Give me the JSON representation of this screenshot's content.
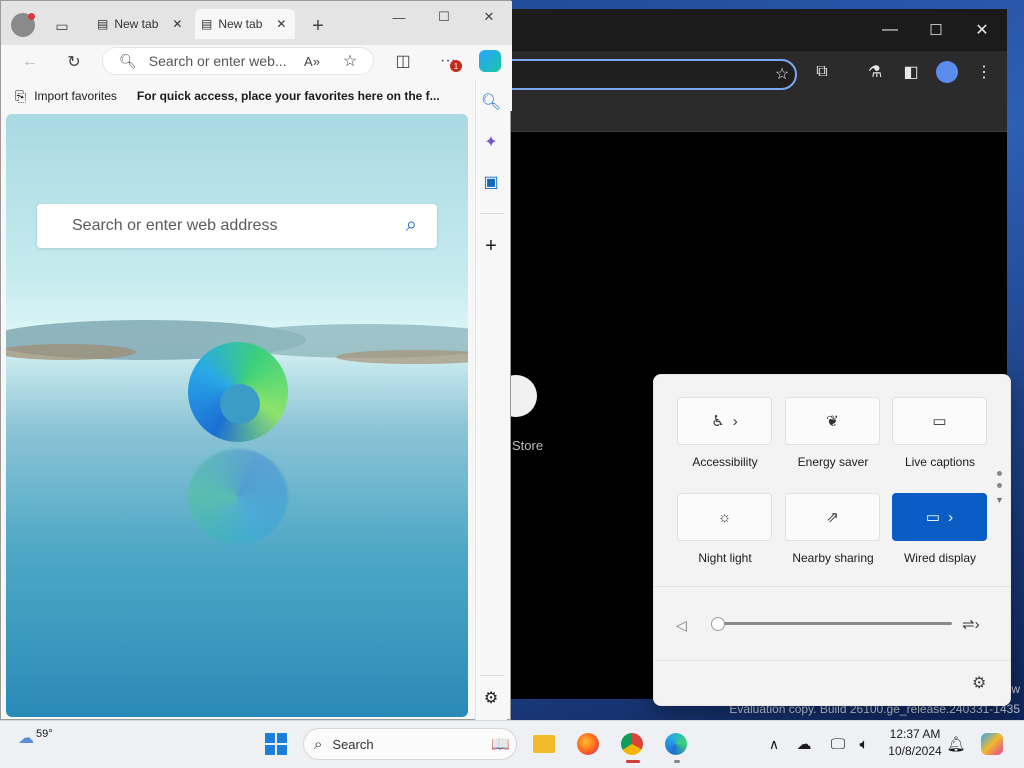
{
  "desktop": {
    "watermark": "Evaluation copy. Build 26100.ge_release.240331-1435",
    "edition_hint": "w"
  },
  "chrome": {
    "store_label": "Store",
    "controls": {
      "minimize": "—",
      "maximize": "☐",
      "close": "✕"
    }
  },
  "edge": {
    "tabs": [
      {
        "label": "New tab"
      },
      {
        "label": "New tab"
      }
    ],
    "new_tab_symbol": "+",
    "address_placeholder": "Search or enter web...",
    "favorites": {
      "import": "Import favorites",
      "hint": "For quick access, place your favorites here on the f..."
    },
    "page_search_placeholder": "Search or enter web address",
    "notification_badge": "1"
  },
  "quick_settings": {
    "tiles": [
      {
        "label": "Accessibility",
        "icon": "accessibility-icon",
        "active": false
      },
      {
        "label": "Energy saver",
        "icon": "leaf-icon",
        "active": false
      },
      {
        "label": "Live captions",
        "icon": "captions-icon",
        "active": false
      },
      {
        "label": "Night light",
        "icon": "sun-icon",
        "active": false
      },
      {
        "label": "Nearby sharing",
        "icon": "share-icon",
        "active": false
      },
      {
        "label": "Wired display",
        "icon": "cast-icon",
        "active": true
      }
    ],
    "volume_level": 0,
    "accent": "#0b5cc4"
  },
  "taskbar": {
    "weather_temp": "59°",
    "search_label": "Search",
    "time": "12:37 AM",
    "date": "10/8/2024"
  }
}
